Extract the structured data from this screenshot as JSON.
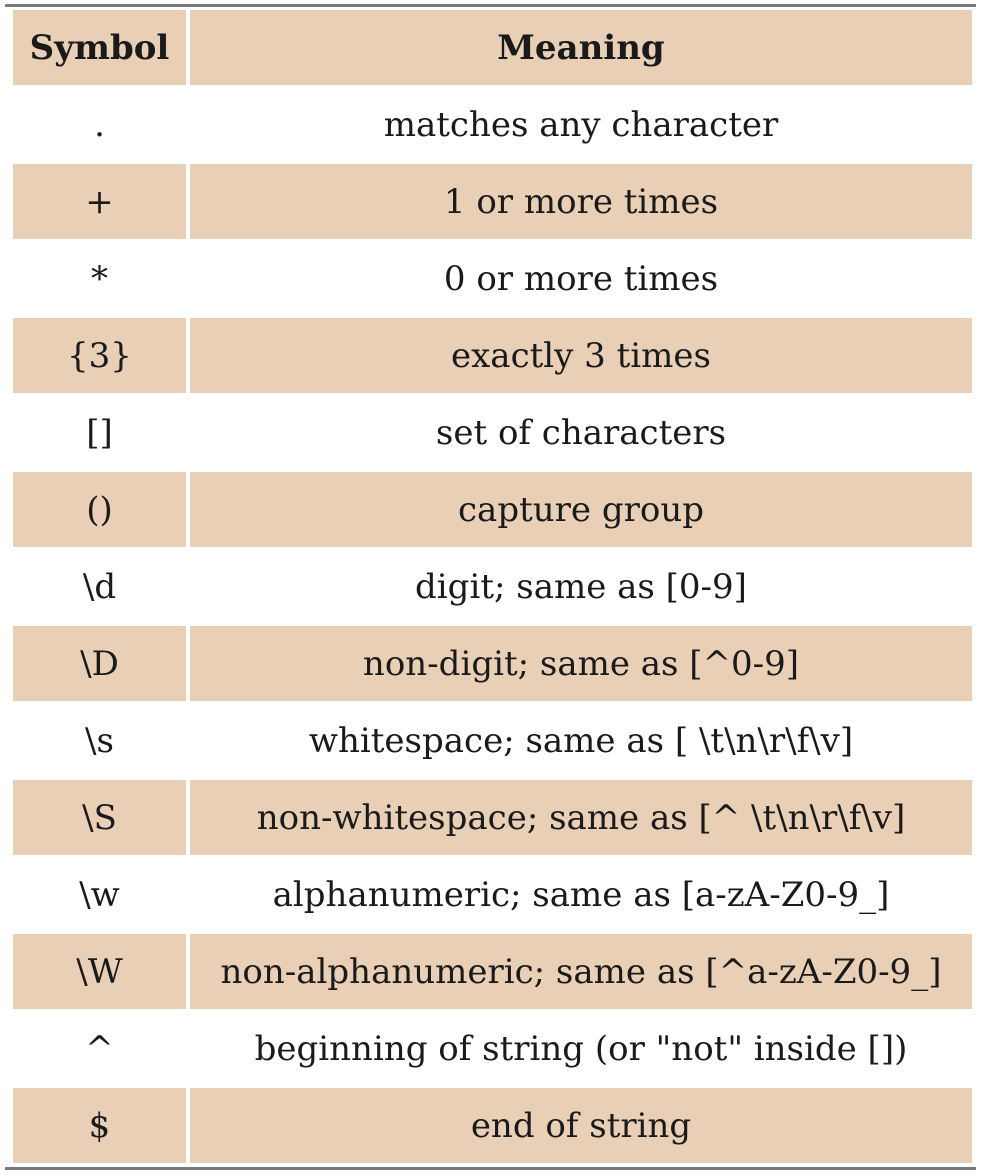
{
  "table": {
    "header": {
      "symbol": "Symbol",
      "meaning": "Meaning"
    },
    "rows": [
      {
        "symbol": ".",
        "meaning": "matches any character"
      },
      {
        "symbol": "+",
        "meaning": "1 or more times"
      },
      {
        "symbol": "*",
        "meaning": "0 or more times"
      },
      {
        "symbol": "{3}",
        "meaning": "exactly 3 times"
      },
      {
        "symbol": "[]",
        "meaning": "set of characters"
      },
      {
        "symbol": "()",
        "meaning": "capture group"
      },
      {
        "symbol": "\\d",
        "meaning": "digit; same as [0-9]"
      },
      {
        "symbol": "\\D",
        "meaning": "non-digit; same as [^0-9]"
      },
      {
        "symbol": "\\s",
        "meaning": "whitespace; same as [ \\t\\n\\r\\f\\v]"
      },
      {
        "symbol": "\\S",
        "meaning": "non-whitespace; same as [^ \\t\\n\\r\\f\\v]"
      },
      {
        "symbol": "\\w",
        "meaning": "alphanumeric; same as [a-zA-Z0-9_]"
      },
      {
        "symbol": "\\W",
        "meaning": "non-alphanumeric; same as [^a-zA-Z0-9_]"
      },
      {
        "symbol": "^",
        "meaning": "beginning of string (or \"not\" inside [])"
      },
      {
        "symbol": "$",
        "meaning": "end of string"
      }
    ]
  },
  "colors": {
    "shaded_row": "#e8cfb5",
    "plain_row": "#ffffff",
    "rule": "#7a7a7a",
    "text": "#1a1a1a"
  }
}
